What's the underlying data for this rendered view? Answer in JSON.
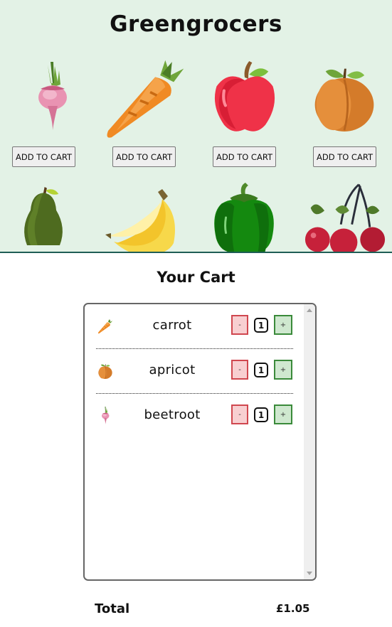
{
  "shop": {
    "title": "Greengrocers",
    "add_button_label": "ADD TO CART",
    "products": [
      {
        "icon": "beetroot-icon"
      },
      {
        "icon": "carrot-icon"
      },
      {
        "icon": "apple-icon"
      },
      {
        "icon": "apricot-icon"
      },
      {
        "icon": "avocado-icon"
      },
      {
        "icon": "bananas-icon"
      },
      {
        "icon": "bell-pepper-icon"
      },
      {
        "icon": "cherry-icon"
      }
    ]
  },
  "cart": {
    "title": "Your Cart",
    "minus_label": "-",
    "plus_label": "+",
    "items": [
      {
        "name": "carrot",
        "quantity": "1",
        "icon": "carrot-icon"
      },
      {
        "name": "apricot",
        "quantity": "1",
        "icon": "apricot-icon"
      },
      {
        "name": "beetroot",
        "quantity": "1",
        "icon": "beetroot-icon"
      }
    ],
    "total_label": "Total",
    "total_value": "£1.05"
  },
  "colors": {
    "shop_background": "#e3f2e6",
    "minus_button": "#f8cfd1",
    "plus_button": "#cfe8cf"
  }
}
